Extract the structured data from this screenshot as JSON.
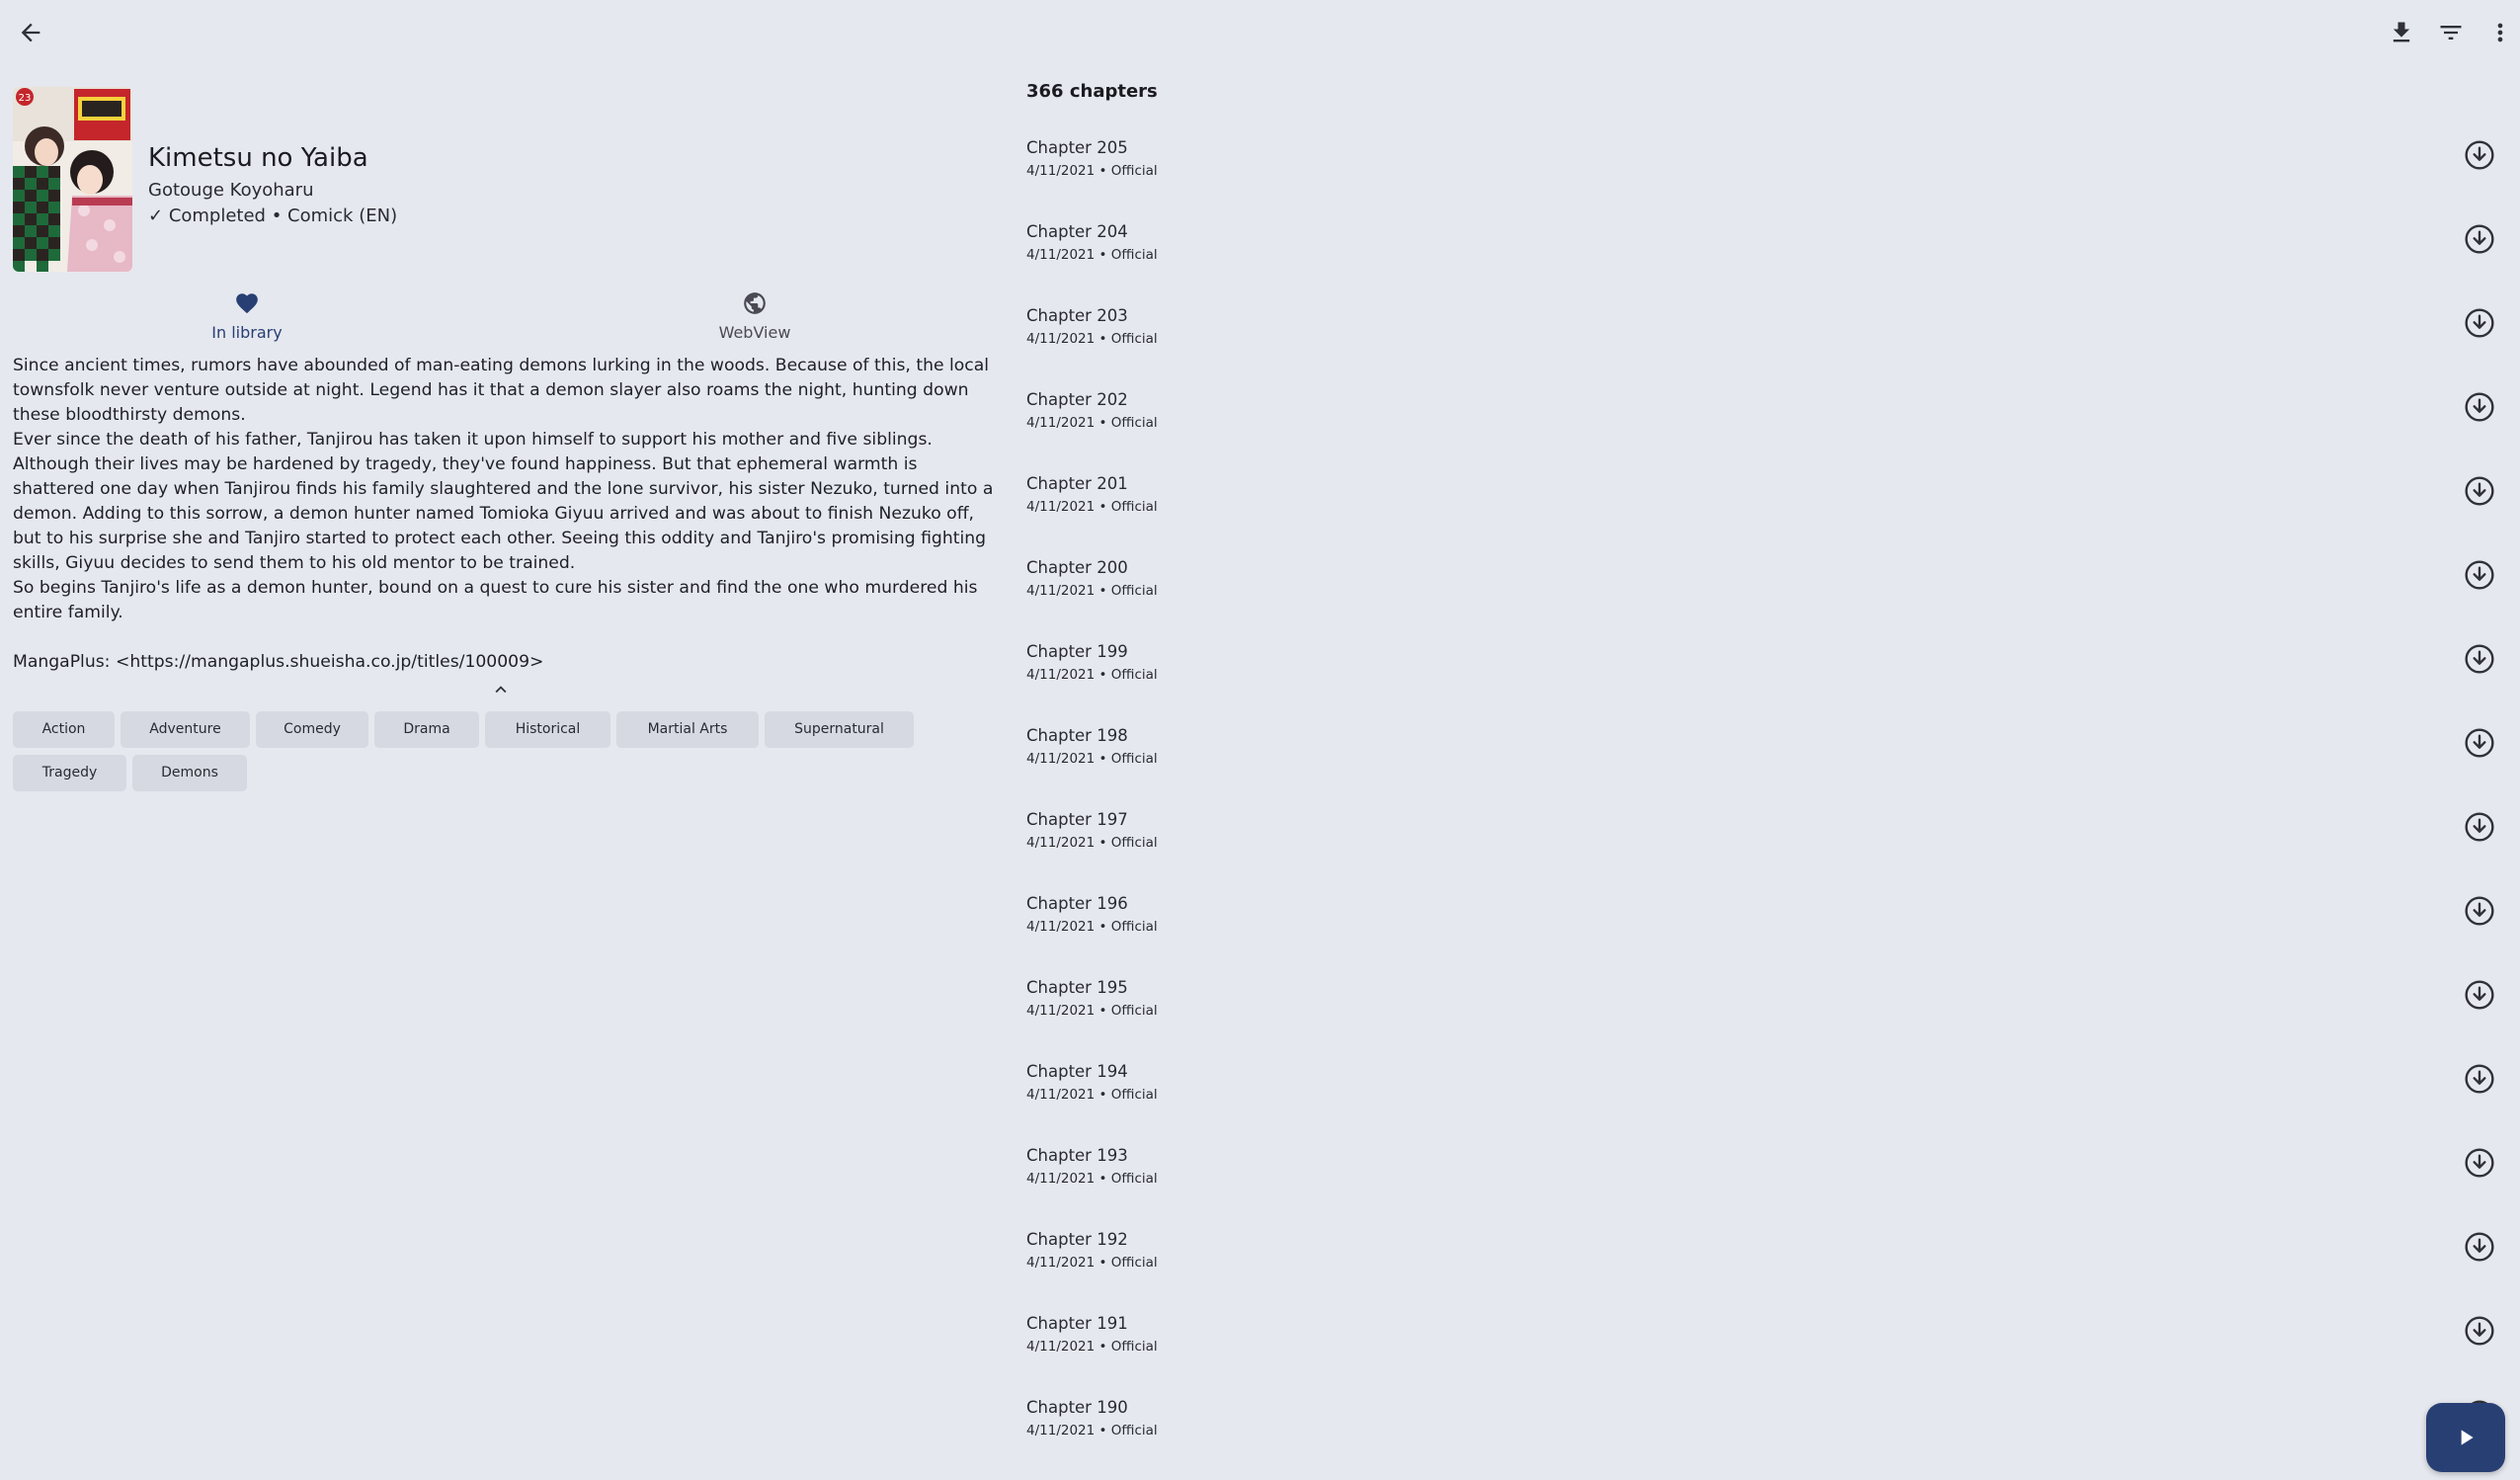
{
  "toolbar": {
    "back_icon": "arrow-back-icon",
    "download_icon": "download-icon",
    "filter_icon": "filter-icon",
    "more_icon": "more-vert-icon"
  },
  "manga": {
    "title": "Kimetsu no Yaiba",
    "author": "Gotouge Koyoharu",
    "status": "Completed • Comick (EN)",
    "cover_volume": "23"
  },
  "actions": {
    "library_label": "In library",
    "webview_label": "WebView"
  },
  "description": {
    "paragraphs": [
      "Since ancient times, rumors have abounded of man-eating demons lurking in the woods. Because of this, the local townsfolk never venture outside at night. Legend has it that a demon slayer also roams the night, hunting down these bloodthirsty demons.",
      "Ever since the death of his father, Tanjirou has taken it upon himself to support his mother and five siblings. Although their lives may be hardened by tragedy, they've found happiness. But that ephemeral warmth is shattered one day when Tanjirou finds his family slaughtered and the lone survivor, his sister Nezuko, turned into a demon. Adding to this sorrow, a demon hunter named Tomioka Giyuu arrived and was about to finish Nezuko off, but to his surprise she and Tanjiro started to protect each other. Seeing this oddity and Tanjiro's promising fighting skills, Giyuu decides to send them to his old mentor to be trained.",
      "So begins Tanjiro's life as a demon hunter, bound on a quest to cure his sister and find the one who murdered his entire family."
    ],
    "link": "MangaPlus: <https://mangaplus.shueisha.co.jp/titles/100009>"
  },
  "tags": [
    "Action",
    "Adventure",
    "Comedy",
    "Drama",
    "Historical",
    "Martial Arts",
    "Supernatural",
    "Tragedy",
    "Demons"
  ],
  "chapters": {
    "count_label": "366 chapters",
    "items": [
      {
        "name": "Chapter 205",
        "meta": "4/11/2021 • Official"
      },
      {
        "name": "Chapter 204",
        "meta": "4/11/2021 • Official"
      },
      {
        "name": "Chapter 203",
        "meta": "4/11/2021 • Official"
      },
      {
        "name": "Chapter 202",
        "meta": "4/11/2021 • Official"
      },
      {
        "name": "Chapter 201",
        "meta": "4/11/2021 • Official"
      },
      {
        "name": "Chapter 200",
        "meta": "4/11/2021 • Official"
      },
      {
        "name": "Chapter 199",
        "meta": "4/11/2021 • Official"
      },
      {
        "name": "Chapter 198",
        "meta": "4/11/2021 • Official"
      },
      {
        "name": "Chapter 197",
        "meta": "4/11/2021 • Official"
      },
      {
        "name": "Chapter 196",
        "meta": "4/11/2021 • Official"
      },
      {
        "name": "Chapter 195",
        "meta": "4/11/2021 • Official"
      },
      {
        "name": "Chapter 194",
        "meta": "4/11/2021 • Official"
      },
      {
        "name": "Chapter 193",
        "meta": "4/11/2021 • Official"
      },
      {
        "name": "Chapter 192",
        "meta": "4/11/2021 • Official"
      },
      {
        "name": "Chapter 191",
        "meta": "4/11/2021 • Official"
      },
      {
        "name": "Chapter 190",
        "meta": "4/11/2021 • Official"
      }
    ]
  },
  "colors": {
    "background": "#e6e8ef",
    "accent": "#283f74",
    "tag_background": "#d6d9e2"
  }
}
